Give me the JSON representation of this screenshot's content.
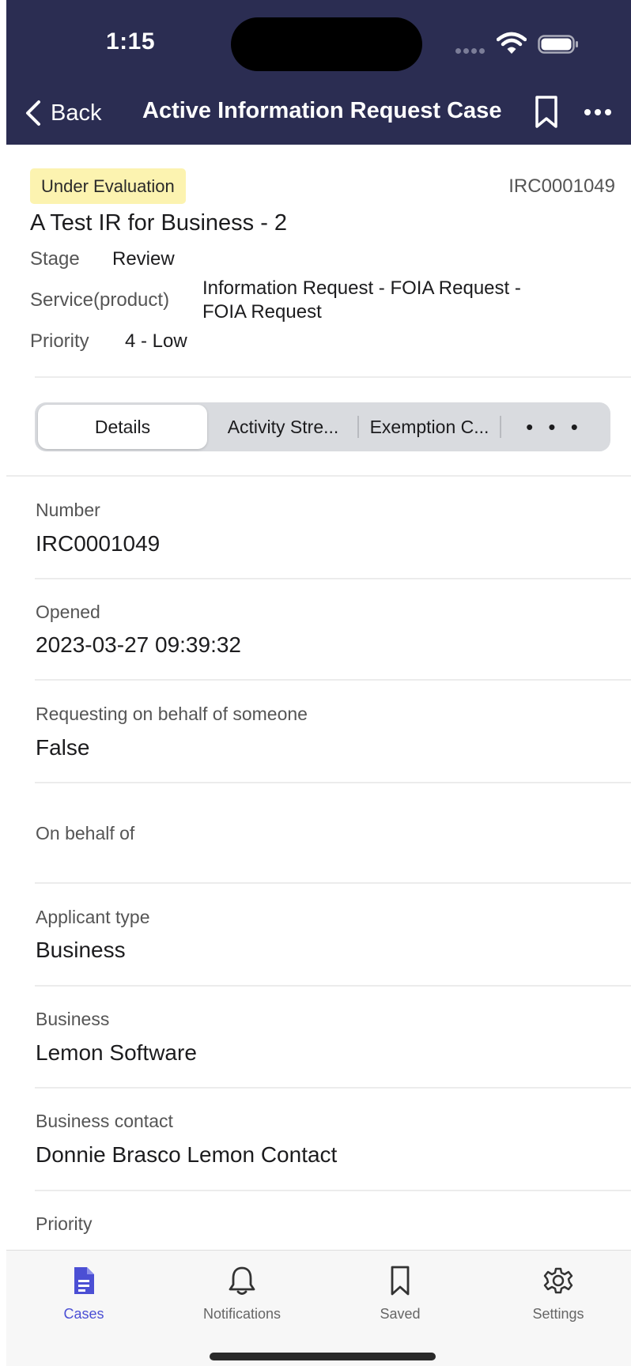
{
  "status_bar": {
    "time": "1:15"
  },
  "header": {
    "back_label": "Back",
    "title": "Active Information Request Case",
    "background": "#2b2d52"
  },
  "summary": {
    "status_badge": "Under Evaluation",
    "number": "IRC0001049",
    "title": "A Test IR for Business - 2",
    "stage_label": "Stage",
    "stage_value": "Review",
    "service_label": "Service(product)",
    "service_value_line1": "Information Request - FOIA Request -",
    "service_value_line2": "FOIA Request",
    "priority_label": "Priority",
    "priority_value": "4 - Low",
    "badge_color": "#fcf3b0"
  },
  "tabs": {
    "details": "Details",
    "activity": "Activity Stre...",
    "exemption": "Exemption C...",
    "more": "• • •"
  },
  "fields": [
    {
      "label": "Number",
      "value": "IRC0001049"
    },
    {
      "label": "Opened",
      "value": "2023-03-27 09:39:32"
    },
    {
      "label": "Requesting on behalf of someone",
      "value": "False"
    },
    {
      "label": "On behalf of",
      "value": ""
    },
    {
      "label": "Applicant type",
      "value": "Business"
    },
    {
      "label": "Business",
      "value": "Lemon Software"
    },
    {
      "label": "Business contact",
      "value": "Donnie Brasco Lemon Contact"
    },
    {
      "label": "Priority",
      "value": ""
    }
  ],
  "tabbar": {
    "cases": "Cases",
    "notifications": "Notifications",
    "saved": "Saved",
    "settings": "Settings",
    "accent": "#4b4fd4"
  }
}
